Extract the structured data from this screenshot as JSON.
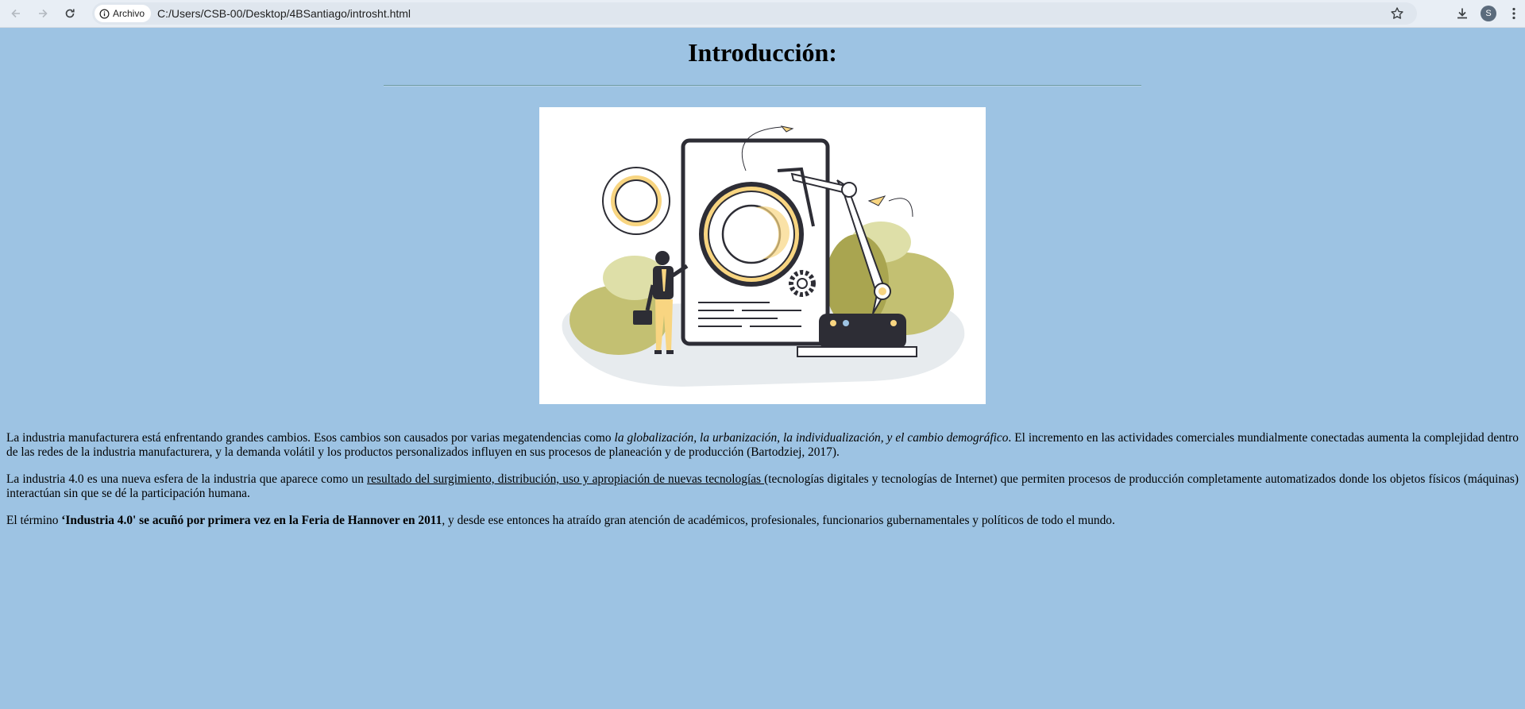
{
  "browser": {
    "back_icon": "arrow-left-icon",
    "forward_icon": "arrow-right-icon",
    "reload_icon": "reload-icon",
    "site_chip_label": "Archivo",
    "url": "C:/Users/CSB-00/Desktop/4BSantiago/introsht.html",
    "profile_initial": "S"
  },
  "page": {
    "title": "Introducción:",
    "background_color": "#9dc3e3",
    "hero_image": "industry-4-0-illustration",
    "paragraphs": [
      {
        "p1_a": "La industria manufacturera está enfrentando grandes cambios. Esos cambios son causados por varias megatendencias como ",
        "p1_em": "la globalización, la urbanización, la individualización, y el cambio demográfico",
        "p1_b": ". El incremento en las actividades comerciales mundialmente conectadas aumenta la complejidad dentro de las redes de la industria manufacturera, y la demanda volátil y los productos personalizados influyen en sus procesos de planeación y de producción (Bartodziej, 2017)."
      },
      {
        "p2_a": "La industria 4.0 es una nueva esfera de la industria que aparece como un ",
        "p2_u": "resultado del surgimiento, distribución, uso y apropiación de nuevas tecnologías ",
        "p2_b": "(tecnologías digitales y tecnologías de Internet) que permiten procesos de producción completamente automatizados donde los objetos físicos (máquinas) interactúan sin que se dé la participación humana."
      },
      {
        "p3_a": "El término ",
        "p3_bold": "‘Industria 4.0' se acuñó por primera vez en la Feria de Hannover en 2011",
        "p3_b": ", y desde ese entonces ha atraído gran atención de académicos, profesionales, funcionarios gubernamentales y políticos de todo el mundo."
      }
    ]
  }
}
